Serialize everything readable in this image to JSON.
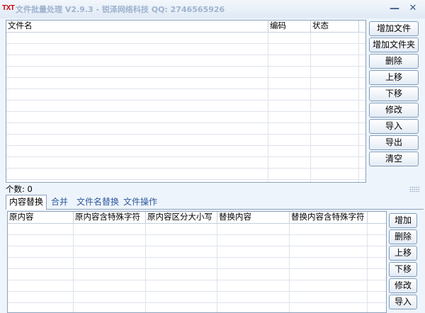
{
  "window": {
    "logo": "TXT",
    "title": "文件批量处理 V2.9.3 - 锐泽网络科技 QQ: 2746565926",
    "minimize": "—",
    "close": "✕"
  },
  "file_table": {
    "columns": [
      "文件名",
      "编码",
      "状态"
    ]
  },
  "file_buttons": [
    "增加文件",
    "增加文件夹",
    "删除",
    "上移",
    "下移",
    "修改",
    "导入",
    "导出",
    "清空"
  ],
  "status": {
    "count": "个数: 0"
  },
  "tabs": [
    "内容替换",
    "合并",
    "文件名替换",
    "文件操作"
  ],
  "active_tab": "内容替换",
  "replace_table": {
    "columns": [
      "原内容",
      "原内容含特殊字符",
      "原内容区分大小写",
      "替换内容",
      "替换内容含特殊字符"
    ]
  },
  "replace_buttons": [
    "增加",
    "删除",
    "上移",
    "下移",
    "修改",
    "导入"
  ],
  "colors": {
    "background": "#eef4fb",
    "border": "#8da2bd",
    "logo": "#cc0000",
    "title_text": "#9fb3cf"
  },
  "icons": {
    "minimize": "minimize-icon",
    "close": "close-icon",
    "resize_grip": "resize-grip-icon"
  }
}
